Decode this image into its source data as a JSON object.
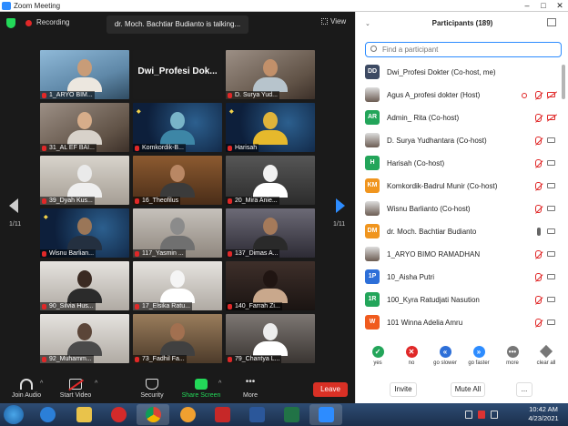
{
  "window": {
    "title": "Zoom Meeting"
  },
  "topbar": {
    "recording": "Recording",
    "talking": "dr. Moch. Bachtiar Budianto is talking...",
    "view": "View"
  },
  "gallery": {
    "page_left": "1/11",
    "page_right": "1/11",
    "tiles": [
      {
        "label": "1_ARYO BIM..."
      },
      {
        "label": "",
        "name": "Dwi_Profesi  Dok..."
      },
      {
        "label": "D. Surya Yud..."
      },
      {
        "label": "31_AL EF BAI..."
      },
      {
        "label": "Komkordik-B..."
      },
      {
        "label": "Harisah"
      },
      {
        "label": "39_Dyah Kus..."
      },
      {
        "label": "16_Theofilus"
      },
      {
        "label": "20_Mira Anie..."
      },
      {
        "label": "Wisnu Barlian..."
      },
      {
        "label": "117_Yasmin ..."
      },
      {
        "label": "137_Dimas A..."
      },
      {
        "label": "90_Silvia Hus..."
      },
      {
        "label": "17_Elsika Ratu..."
      },
      {
        "label": "140_Farrah Zi..."
      },
      {
        "label": "92_Muhamm..."
      },
      {
        "label": "73_Fadhil Fa..."
      },
      {
        "label": "79_Chantya L..."
      }
    ]
  },
  "toolbar": {
    "join_audio": "Join Audio",
    "start_video": "Start Video",
    "security": "Security",
    "share_screen": "Share Screen",
    "more": "More",
    "leave": "Leave"
  },
  "participants": {
    "title": "Participants (189)",
    "search_placeholder": "Find a participant",
    "list": [
      {
        "initials": "DD",
        "color": "#3d4a63",
        "name": "Dwi_Profesi Dokter (Co-host, me)",
        "mic": "",
        "video": ""
      },
      {
        "initials": "",
        "color": "",
        "name": "Agus A_profesi dokter (Host)",
        "mic": "muted",
        "video": "off",
        "rec": true
      },
      {
        "initials": "AR",
        "color": "#23a55a",
        "name": "Admin_ Rita (Co-host)",
        "mic": "muted",
        "video": "off"
      },
      {
        "initials": "",
        "color": "",
        "name": "D. Surya Yudhantara (Co-host)",
        "mic": "muted",
        "video": "on"
      },
      {
        "initials": "H",
        "color": "#23a55a",
        "name": "Harisah (Co-host)",
        "mic": "muted",
        "video": "on"
      },
      {
        "initials": "KM",
        "color": "#f0951e",
        "name": "Komkordik-Badrul Munir (Co-host)",
        "mic": "muted",
        "video": "on"
      },
      {
        "initials": "",
        "color": "",
        "name": "Wisnu Barlianto (Co-host)",
        "mic": "muted",
        "video": "on"
      },
      {
        "initials": "DM",
        "color": "#f0951e",
        "name": "dr. Moch. Bachtiar Budianto",
        "mic": "on",
        "video": "on"
      },
      {
        "initials": "",
        "color": "",
        "name": "1_ARYO BIMO RAMADHAN",
        "mic": "muted",
        "video": "on"
      },
      {
        "initials": "1P",
        "color": "#2d6fd8",
        "name": "10_Aisha Putri",
        "mic": "muted",
        "video": "on"
      },
      {
        "initials": "1R",
        "color": "#23a55a",
        "name": "100_Kyra Ratudjati Nasution",
        "mic": "muted",
        "video": "on"
      },
      {
        "initials": "W",
        "color": "#f05b1e",
        "name": "101 Winna Adelia Amru",
        "mic": "muted",
        "video": "on"
      }
    ],
    "reactions": [
      {
        "label": "yes",
        "color": "#23a55a",
        "glyph": "✓"
      },
      {
        "label": "no",
        "color": "#e02828",
        "glyph": "✕"
      },
      {
        "label": "go slower",
        "color": "#2d6fd8",
        "glyph": "«"
      },
      {
        "label": "go faster",
        "color": "#2d8cff",
        "glyph": "»"
      },
      {
        "label": "more",
        "color": "#777",
        "glyph": "•••"
      },
      {
        "label": "clear all",
        "color": "",
        "glyph": ""
      }
    ],
    "invite": "Invite",
    "mute_all": "Mute All",
    "more": "..."
  },
  "taskbar": {
    "time": "10:42 AM",
    "date": "4/23/2021"
  }
}
